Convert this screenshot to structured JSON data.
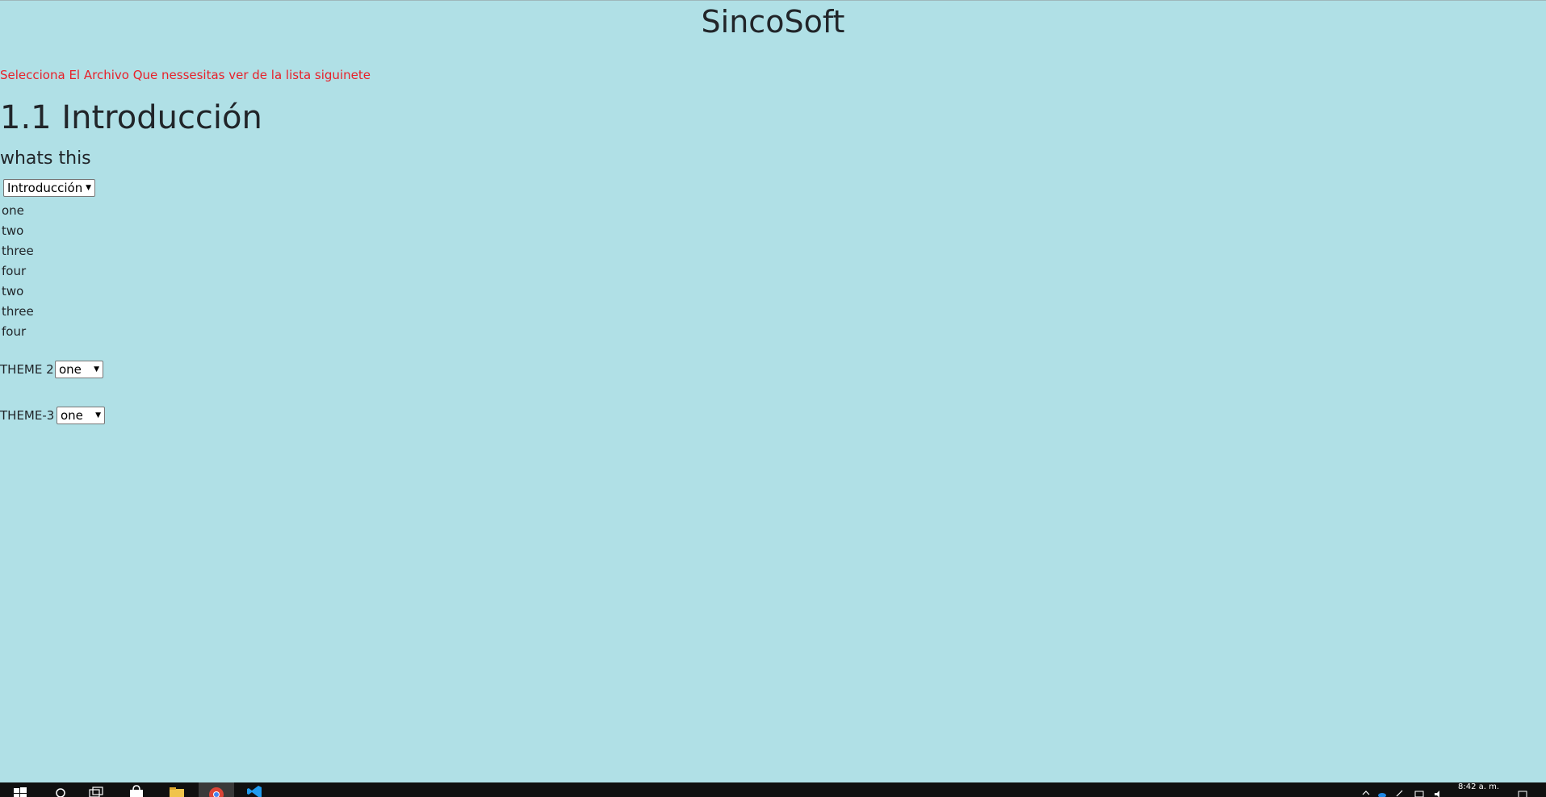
{
  "app": {
    "title": "SincoSoft"
  },
  "instruction": "Selecciona El Archivo Que nessesitas ver de la lista siguinete",
  "section": {
    "title": "1.1 Introducción",
    "subtitle": "whats this"
  },
  "main_select": {
    "selected": "Introducción"
  },
  "list_items": [
    "one",
    "two",
    "three",
    "four",
    "two",
    "three",
    "four"
  ],
  "theme2": {
    "label": "THEME 2",
    "selected": "one"
  },
  "theme3": {
    "label": "THEME-3",
    "selected": "one"
  },
  "taskbar": {
    "clock": "8:42 a. m.",
    "icons": [
      "windows-start-icon",
      "search-icon",
      "task-view-icon",
      "store-icon",
      "file-explorer-icon",
      "chrome-icon",
      "vscode-icon"
    ]
  },
  "colors": {
    "background": "#b0e0e6",
    "instruction_text": "#e8212a",
    "heading_text": "#212529",
    "taskbar": "#101010"
  }
}
